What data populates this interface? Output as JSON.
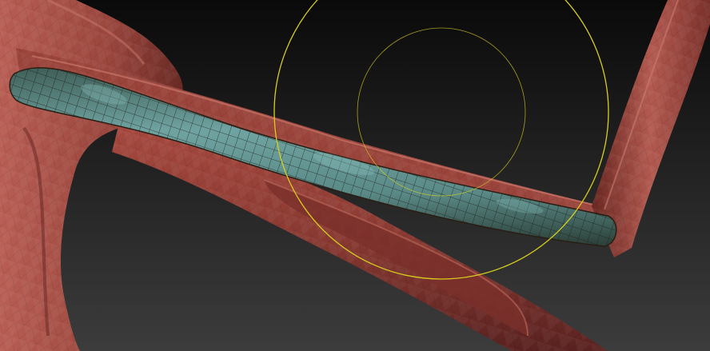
{
  "viewport": {
    "background_top": "#0a0a0a",
    "background_bottom": "#3c3c3c",
    "mesh_color": "#8a3a32",
    "mesh_shadow": "#4a1815",
    "mesh_highlight": "#c0675c",
    "masked_tube_color": "#5f8f8d",
    "masked_tube_dark": "#2f4a44",
    "wireframe_color": "#1e1a14"
  },
  "brush_cursor": {
    "color": "#d8d01c",
    "draw_size_ring": "outer",
    "focal_shift_ring": "inner"
  },
  "icons": {
    "cursor": "brush-circle-icon"
  }
}
